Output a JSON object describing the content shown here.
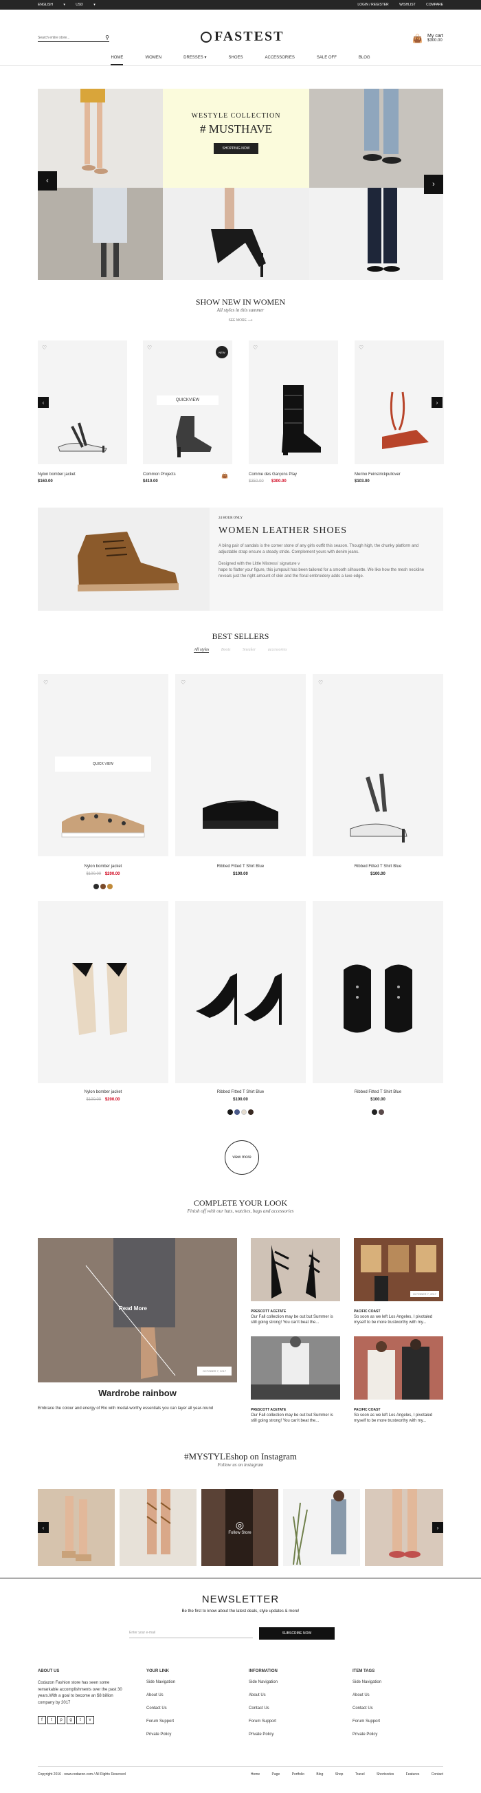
{
  "topbar": {
    "language": "ENGLISH",
    "currency": "USD",
    "login": "LOGIN / REGISTER",
    "wishlist": "WISHLIST",
    "compare": "COMPARE"
  },
  "header": {
    "search_placeholder": "Search entire store...",
    "logo": "FASTEST",
    "cart_label": "My cart",
    "cart_total": "$300.00",
    "cart_count": "0"
  },
  "nav": [
    "HOME",
    "WOMEN",
    "DRESSES",
    "SHOES",
    "ACCESSORIES",
    "SALE OFF",
    "BLOG"
  ],
  "hero": {
    "line1": "WESTYLE COLLECTION",
    "line2": "# MUSTHAVE",
    "button": "SHOPPING NOW"
  },
  "new_in": {
    "title": "SHOW NEW IN WOMEN",
    "subtitle": "All styles in this summer",
    "more": "SEE MORE",
    "products": [
      {
        "name": "Nylon bomber jacket",
        "price": "$160.00"
      },
      {
        "name": "Common Projects",
        "price": "$410.00",
        "badge": "NEW",
        "quickview": "QUICKVIEW"
      },
      {
        "name": "Comme des Garçons Play",
        "old_price": "$350.00",
        "price": "$300.00"
      },
      {
        "name": "Merino Feinstrickpullover",
        "price": "$103.00"
      }
    ]
  },
  "banner": {
    "tag": "24 HOUR ONLY",
    "title": "WOMEN LEATHER SHOES",
    "p1": "A bling pair of sandals is the corner stone of any girls outfit this season. Though high, the chunky platform and adjustable strap ensure a steady stride. Complement yours with denim jeans.",
    "p2": "Designed with the Little Mistress' signature v\nhape to flatter your figure, this jumpsuit has been tailored for a smooth silhouette. We like how the mesh neckline reveals just the right amount of skin and the floral embroidery adds a luxe edge."
  },
  "best_sellers": {
    "title": "BEST SELLERS",
    "tabs": [
      "All styles",
      "Boots",
      "Sneaker",
      "accessories"
    ],
    "quickview": "QUICK VIEW",
    "products": [
      {
        "name": "Nylon bomber jacket",
        "old_price": "$100.00",
        "price": "$200.00",
        "colors": [
          "#2b2b2b",
          "#7a4a2a",
          "#c08a3a"
        ]
      },
      {
        "name": "Ribbed Fitted T Shirt Blue",
        "price": "$100.00"
      },
      {
        "name": "Ribbed Fitted T Shirt Blue",
        "price": "$100.00"
      },
      {
        "name": "Nylon bomber jacket",
        "old_price": "$100.00",
        "price": "$200.00"
      },
      {
        "name": "Ribbed Fitted T Shirt Blue",
        "price": "$100.00",
        "colors": [
          "#1a1a1a",
          "#4a5a8a",
          "#e5dccf",
          "#3a2a22"
        ]
      },
      {
        "name": "Ribbed Fitted T Shirt Blue",
        "price": "$100.00",
        "colors": [
          "#222222",
          "#5a4a4a"
        ]
      }
    ],
    "view_more": "view more"
  },
  "look": {
    "title": "COMPLETE YOUR LOOK",
    "subtitle": "Finish off with our hats, watches, bags and accessories",
    "main_caption": "Wardrobe rainbow",
    "main_text": "Embrace the colour and energy of Rio with medal-worthy essentials you can layer all year-round",
    "read_more": "Read More",
    "date": "OCTOBER 7, 2017",
    "posts": [
      {
        "title": "PRESCOTT ACETATE",
        "text": "Our Fall collection may be out but Summer is still going strong! You can't beat the..."
      },
      {
        "title": "PACIFIC COAST",
        "text": "So soon as we left Los Angeles, I pivotaled myself to be more trustworthy with my..."
      },
      {
        "title": "PRESCOTT ACETATE",
        "text": "Our Fall collection may be out but Summer is still going strong! You can't beat the..."
      },
      {
        "title": "PACIFIC COAST",
        "text": "So soon as we left Los Angeles, I pivotaled myself to be more trustworthy with my..."
      }
    ]
  },
  "instagram": {
    "title": "#MYSTYLEshop on Instagram",
    "subtitle": "Follow us on instagram",
    "follow": "Follow Store"
  },
  "newsletter": {
    "title": "NEWSLETTER",
    "subtitle": "Be the first to know about the latest deals, style updates & more!",
    "placeholder": "Enter your e-mail",
    "button": "SUBSCRIBE NOW"
  },
  "footer": {
    "about_title": "ABOUT US",
    "about_text": "Codazon Fashion store has seen some remarkable accomplishments over the past 30 years.With a goal to become an $8 billion company by 2017",
    "socials": [
      "f",
      "t",
      "p",
      "g",
      "t",
      "v"
    ],
    "link_title": "YOUR LINK",
    "links": [
      "Side Navigation",
      "About Us",
      "Contact Us",
      "Forum Support",
      "Private Policy"
    ],
    "info_title": "INFORMATION",
    "info": [
      "Side Navigation",
      "About Us",
      "Contact Us",
      "Forum Support",
      "Private Policy"
    ],
    "tags_title": "ITEM TAGS",
    "tags": [
      "Side Navigation",
      "About Us",
      "Contact Us",
      "Forum Support",
      "Private Policy"
    ],
    "copyright": "Copyright 2016 · www.codazon.com / All Rights Reserved",
    "bottom_links": [
      "Home",
      "Page",
      "Portfolio",
      "Blog",
      "Shop",
      "Travel",
      "Shortcodes",
      "Features",
      "Contact"
    ]
  }
}
